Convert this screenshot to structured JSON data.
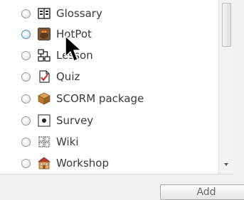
{
  "activity_list": {
    "items": [
      {
        "label": "Glossary",
        "icon": "glossary-icon"
      },
      {
        "label": "HotPot",
        "icon": "hotpot-icon"
      },
      {
        "label": "Lesson",
        "icon": "lesson-icon"
      },
      {
        "label": "Quiz",
        "icon": "quiz-icon"
      },
      {
        "label": "SCORM package",
        "icon": "scorm-package-icon"
      },
      {
        "label": "Survey",
        "icon": "survey-icon"
      },
      {
        "label": "Wiki",
        "icon": "wiki-icon"
      },
      {
        "label": "Workshop",
        "icon": "workshop-icon"
      }
    ]
  },
  "footer": {
    "add_label": "Add"
  },
  "cursor": {
    "icon": "mouse-pointer-icon"
  }
}
